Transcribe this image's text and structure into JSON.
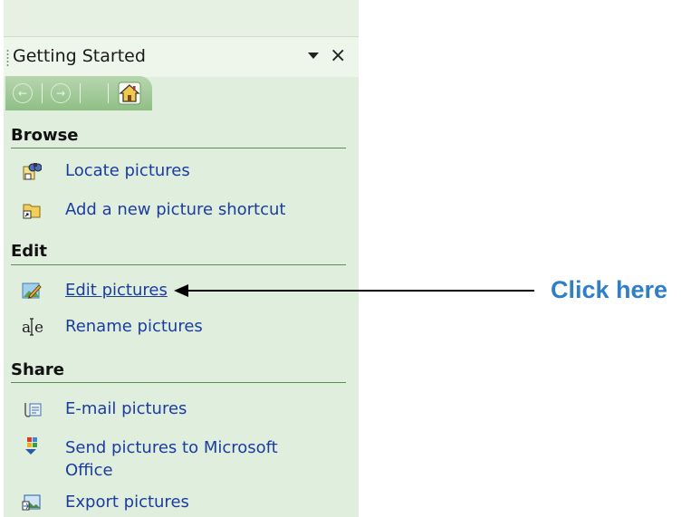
{
  "pane": {
    "title": "Getting Started",
    "close_glyph": "×"
  },
  "nav": {
    "back": "←",
    "forward": "→"
  },
  "sections": {
    "browse": {
      "title": "Browse",
      "items": [
        {
          "label": "Locate pictures",
          "icon": "binoculars-icon"
        },
        {
          "label": "Add a new picture shortcut",
          "icon": "folder-shortcut-icon"
        }
      ]
    },
    "edit": {
      "title": "Edit",
      "items": [
        {
          "label": "Edit pictures",
          "icon": "edit-picture-icon"
        },
        {
          "label": "Rename pictures",
          "icon": "rename-icon"
        }
      ]
    },
    "share": {
      "title": "Share",
      "items": [
        {
          "label": "E-mail pictures",
          "icon": "email-attachment-icon"
        },
        {
          "label": "Send pictures to Microsoft Office",
          "icon": "office-icon"
        },
        {
          "label": "Export pictures",
          "icon": "export-picture-icon"
        }
      ]
    }
  },
  "annotation": {
    "text": "Click here",
    "color": "#2f7fc8"
  },
  "colors": {
    "pane_bg": "#dfeedd",
    "link": "#1c3c9e",
    "nav_bar": "#8fbf85"
  }
}
